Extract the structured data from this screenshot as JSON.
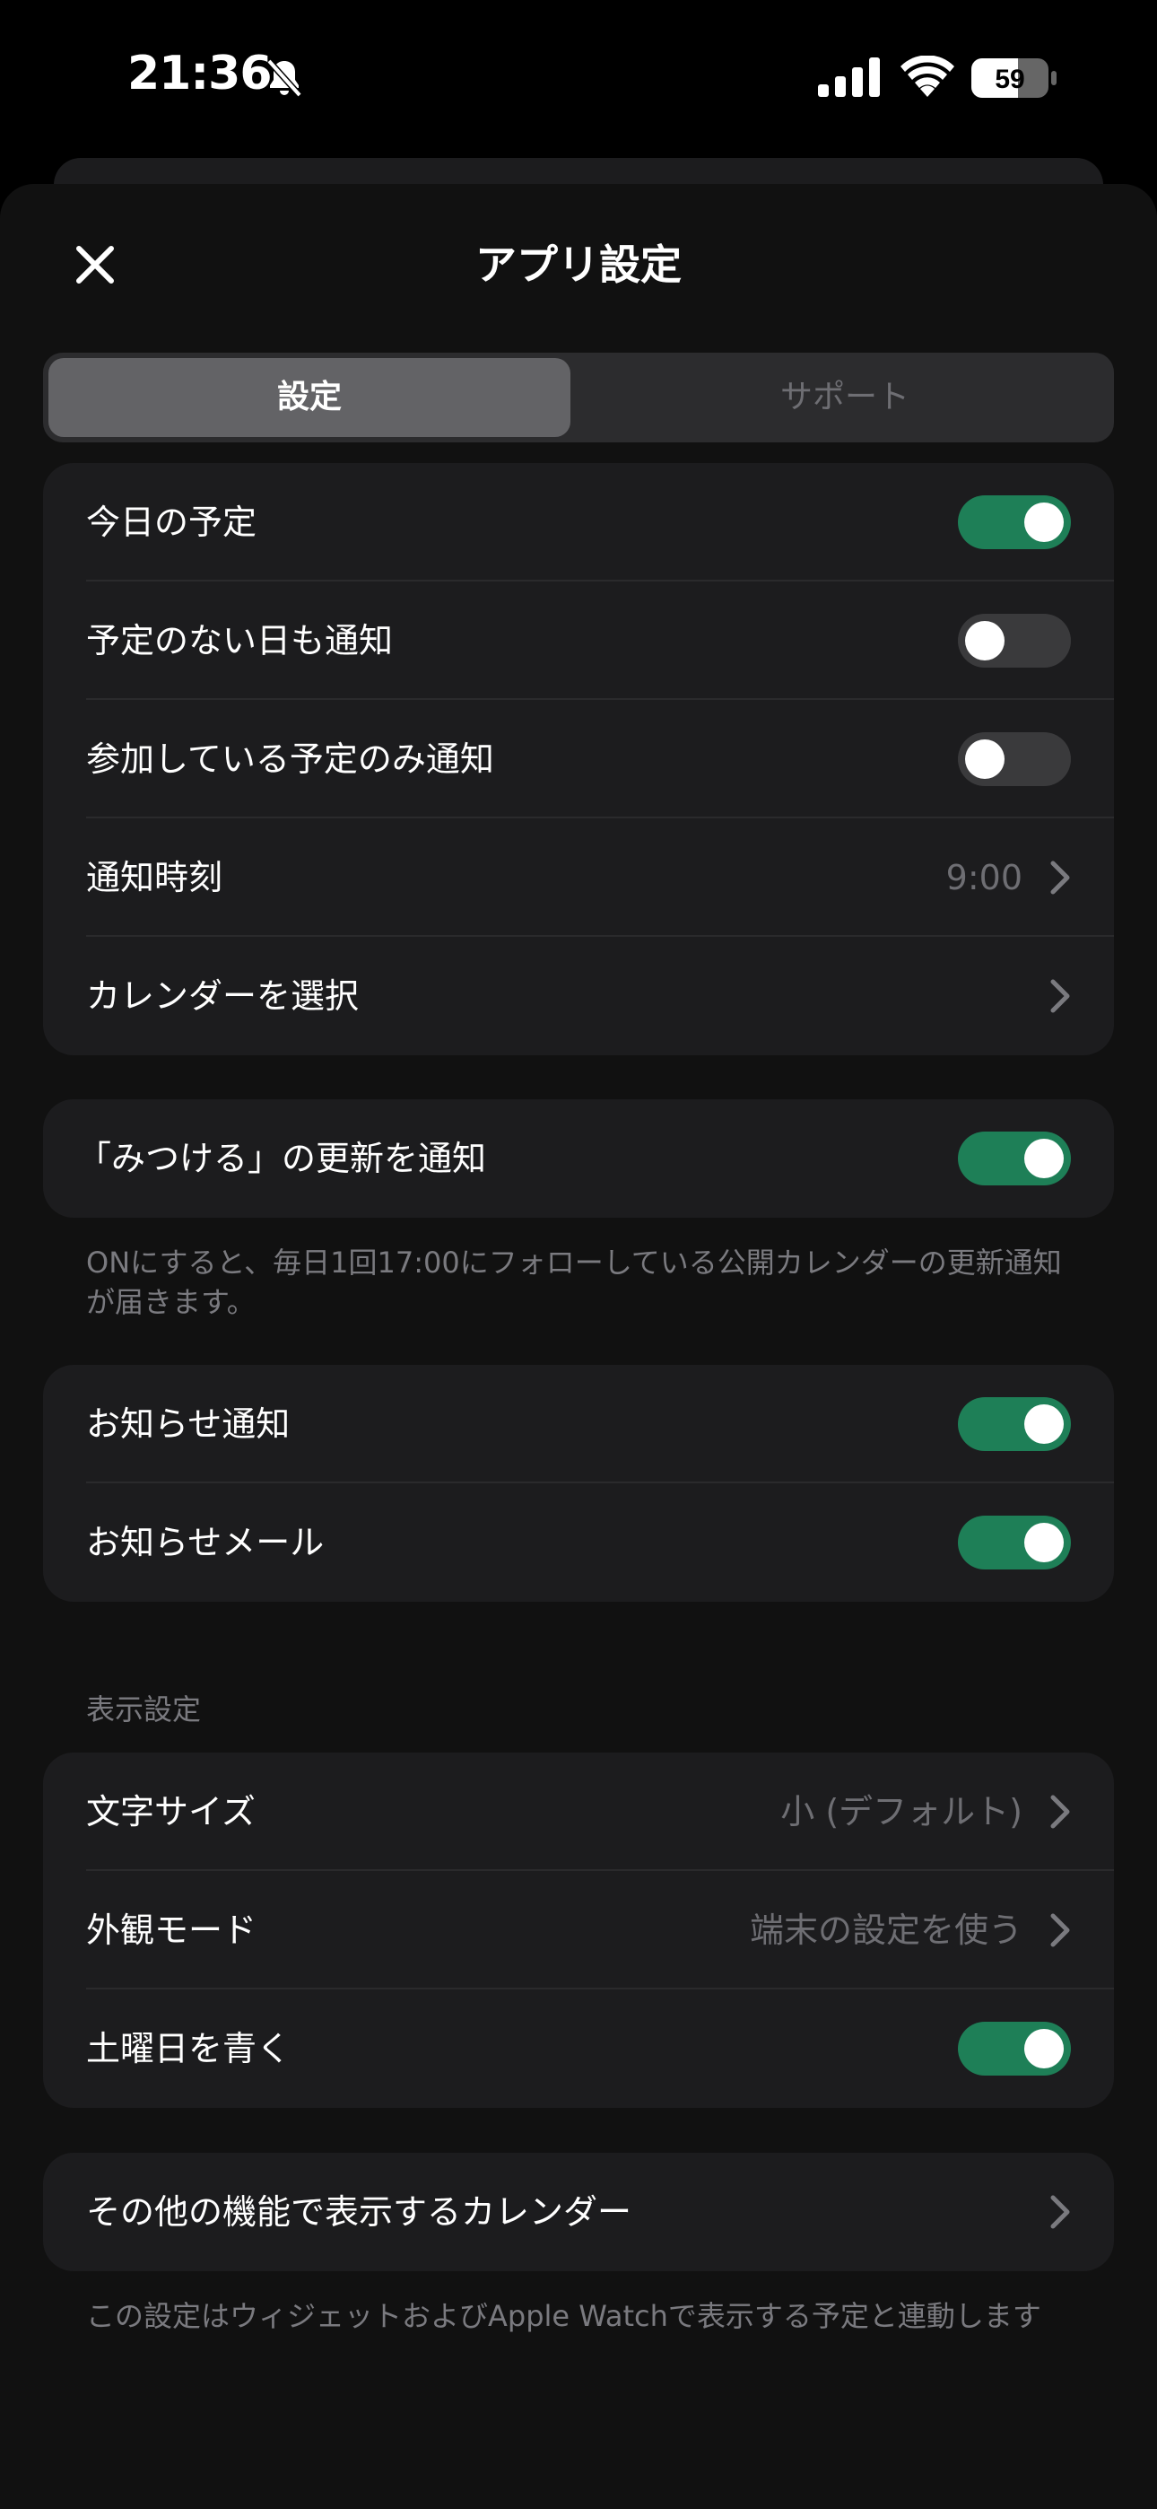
{
  "status_bar": {
    "time": "21:36",
    "battery": "59"
  },
  "header": {
    "title": "アプリ設定"
  },
  "segments": {
    "settings": "設定",
    "support": "サポート"
  },
  "group1": {
    "todays_schedule": {
      "label": "今日の予定",
      "on": true
    },
    "notify_no_schedule": {
      "label": "予定のない日も通知",
      "on": false
    },
    "notify_attending_only": {
      "label": "参加している予定のみ通知",
      "on": false
    },
    "notify_time": {
      "label": "通知時刻",
      "value": "9:00"
    },
    "select_calendar": {
      "label": "カレンダーを選択"
    }
  },
  "group2": {
    "mitsukeru_update": {
      "label": "「みつける」の更新を通知",
      "on": true
    },
    "footnote": "ONにすると、毎日1回17:00にフォローしている公開カレンダーの更新通知が届きます。"
  },
  "group3": {
    "news_notification": {
      "label": "お知らせ通知",
      "on": true
    },
    "news_mail": {
      "label": "お知らせメール",
      "on": true
    }
  },
  "display_settings": {
    "header": "表示設定",
    "font_size": {
      "label": "文字サイズ",
      "value": "小 (デフォルト)"
    },
    "appearance": {
      "label": "外観モード",
      "value": "端末の設定を使う"
    },
    "saturday_blue": {
      "label": "土曜日を青く",
      "on": true
    }
  },
  "group5": {
    "other_calendar": {
      "label": "その他の機能で表示するカレンダー"
    },
    "footnote": "この設定はウィジェットおよびApple Watchで表示する予定と連動します"
  },
  "colors": {
    "toggle_on": "#1e7f57",
    "toggle_off": "#3a3a3c",
    "group_bg": "#1c1c1e"
  }
}
